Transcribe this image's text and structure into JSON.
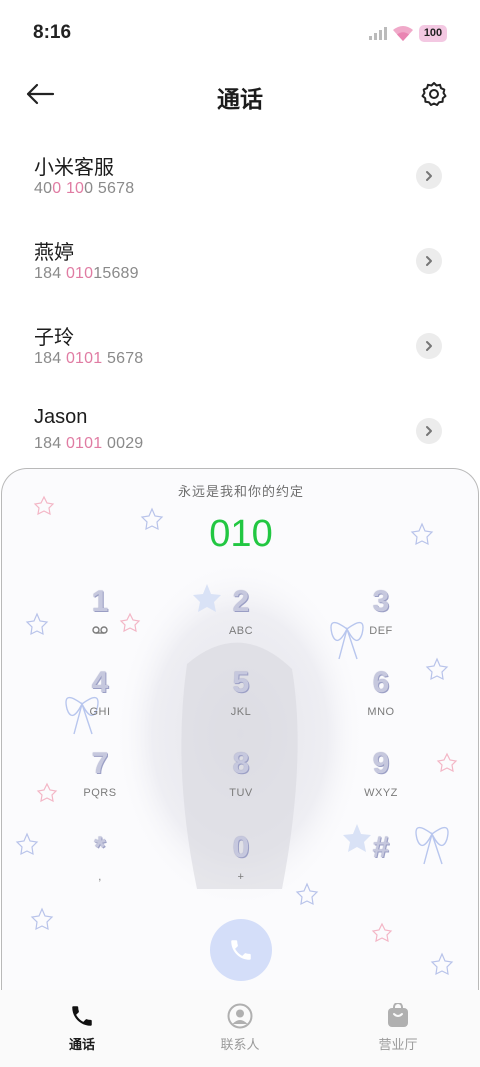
{
  "status_bar": {
    "time": "8:16",
    "battery": "100"
  },
  "header": {
    "title": "通话"
  },
  "contacts": [
    {
      "name": "小米客服",
      "number_parts": [
        "40",
        "0 10",
        "0 5678"
      ]
    },
    {
      "name": "燕婷",
      "number_parts": [
        "184 ",
        "010",
        "15689"
      ]
    },
    {
      "name": "子玲",
      "number_parts": [
        "184 ",
        "0101",
        " 5678"
      ]
    },
    {
      "name": "Jason",
      "number_parts": [
        "184 ",
        "0101",
        " 0029"
      ]
    }
  ],
  "dialpad": {
    "motto": "永远是我和你的约定",
    "dialed_number": "010",
    "keys": [
      {
        "digit": "1",
        "sub": "voicemail"
      },
      {
        "digit": "2",
        "sub": "ABC"
      },
      {
        "digit": "3",
        "sub": "DEF"
      },
      {
        "digit": "4",
        "sub": "GHI"
      },
      {
        "digit": "5",
        "sub": "JKL"
      },
      {
        "digit": "6",
        "sub": "MNO"
      },
      {
        "digit": "7",
        "sub": "PQRS"
      },
      {
        "digit": "8",
        "sub": "TUV"
      },
      {
        "digit": "9",
        "sub": "WXYZ"
      },
      {
        "digit": "*",
        "sub": ","
      },
      {
        "digit": "0",
        "sub": "+"
      },
      {
        "digit": "#",
        "sub": ""
      }
    ]
  },
  "bottom_nav": [
    {
      "label": "通话",
      "icon": "phone-icon",
      "active": true
    },
    {
      "label": "联系人",
      "icon": "person-icon",
      "active": false
    },
    {
      "label": "营业厅",
      "icon": "shopping-bag-icon",
      "active": false
    }
  ],
  "colors": {
    "accent_green": "#22c742",
    "highlight_pink": "#e07ca3"
  }
}
